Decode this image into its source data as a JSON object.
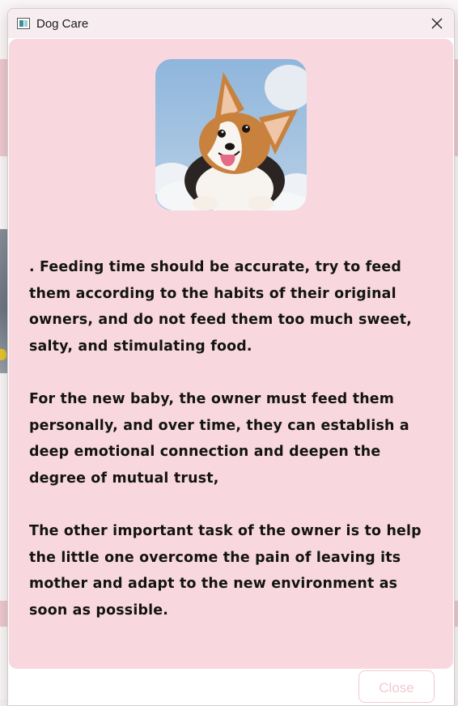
{
  "window": {
    "title": "Dog Care",
    "app_icon": "window-app-icon",
    "close_icon": "close-icon"
  },
  "dialog": {
    "image": "corgi-puppy-photo",
    "paragraphs": [
      " . Feeding time should be accurate, try to feed them according to the habits of their original owners, and do not feed them too much sweet, salty, and stimulating food.",
      " For the new baby, the owner must feed them personally, and over time, they can establish a deep emotional connection and deepen the degree of mutual trust,",
      " The other important task of the owner is to help the little one overcome the pain of leaving its mother and adapt to the new environment as soon as possible."
    ],
    "close_label": "Close"
  },
  "colors": {
    "card_background": "#f8d8de",
    "titlebar_background": "#f7edf1",
    "close_button_text": "#f3c9d0"
  }
}
